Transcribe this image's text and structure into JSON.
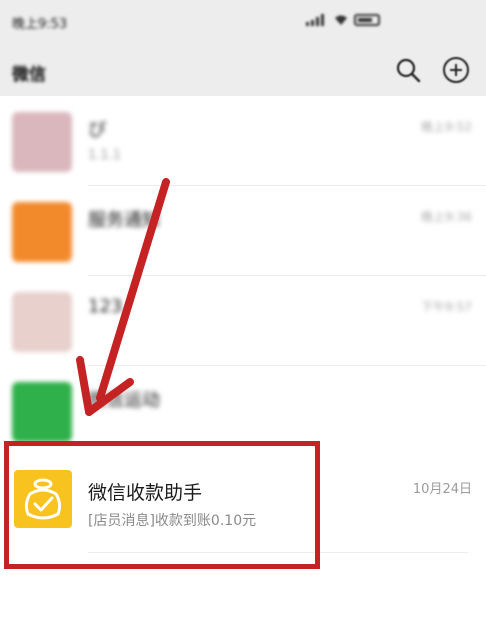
{
  "status_bar": {
    "time": "晚上9:53"
  },
  "app_header": {
    "title": "微信"
  },
  "chats": [
    {
      "title": "ぴ",
      "preview": "1.1.1",
      "time": "晚上9:52",
      "avatar_color": "#d9b7bd"
    },
    {
      "title": "服务通知",
      "preview": "",
      "time": "晚上9:36",
      "avatar_color": "#f28a2c"
    },
    {
      "title": "123",
      "preview": "",
      "time": "下午9:57",
      "avatar_color": "#e8d0cc"
    },
    {
      "title": "微信运动",
      "preview": "",
      "time": "",
      "avatar_color": "#2fb04a"
    }
  ],
  "highlighted_chat": {
    "title": "微信收款助手",
    "preview": "[店员消息]收款到账0.10元",
    "time": "10月24日",
    "avatar_color": "#f8c21f"
  },
  "annotation_color": "#c42223"
}
